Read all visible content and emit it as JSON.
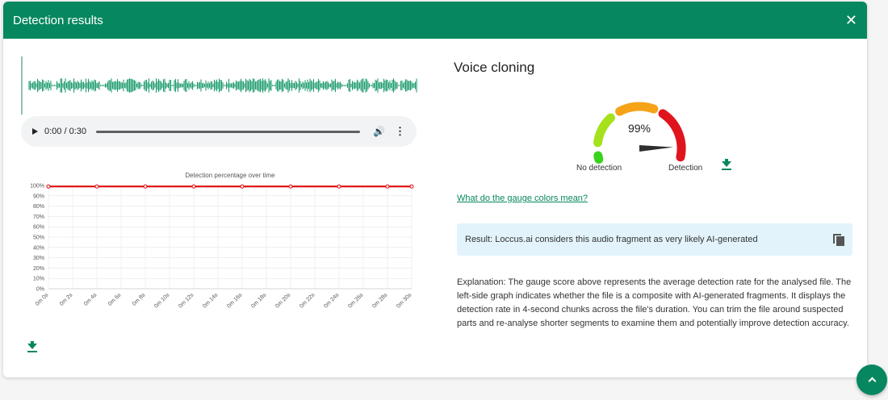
{
  "dialog": {
    "title": "Detection results",
    "close_icon": "close-icon"
  },
  "player": {
    "time": "0:00 / 0:30"
  },
  "voice": {
    "title": "Voice cloning",
    "score": "99%",
    "score_value": 0.99,
    "label_left": "No detection",
    "label_right": "Detection",
    "colors": {
      "green_bright": "#39d21d",
      "green_light": "#a6e11d",
      "orange": "#f5a317",
      "red": "#e0141d",
      "needle": "#2f2f2f"
    }
  },
  "link": "What do the gauge colors mean?",
  "result": "Result: Loccus.ai considers this audio fragment as very likely AI-generated",
  "explanation": "Explanation: The gauge score above represents the average detection rate for the analysed file. The left-side graph indicates whether the file is a composite with AI-generated fragments. It displays the detection rate in 4-second chunks across the file's duration. You can trim the file around suspected parts and re-analyse shorter segments to examine them and potentially improve detection accuracy.",
  "chart_data": {
    "type": "line",
    "title": "Detection percentage over time",
    "xlabel": "",
    "ylabel": "",
    "y_ticks": [
      "0%",
      "10%",
      "20%",
      "30%",
      "40%",
      "50%",
      "60%",
      "70%",
      "80%",
      "90%",
      "100%"
    ],
    "x_ticks": [
      "0m 0s",
      "0m 2s",
      "0m 4s",
      "0m 6s",
      "0m 8s",
      "0m 10s",
      "0m 12s",
      "0m 14s",
      "0m 16s",
      "0m 18s",
      "0m 20s",
      "0m 22s",
      "0m 24s",
      "0m 26s",
      "0m 28s",
      "0m 30s"
    ],
    "ylim": [
      0,
      100
    ],
    "xlim": [
      0,
      30
    ],
    "grid": true,
    "series": [
      {
        "color": "#e00000",
        "x": [
          0,
          4,
          8,
          12,
          16,
          20,
          24,
          28,
          30
        ],
        "y": [
          99,
          99,
          99,
          99,
          99,
          99,
          99,
          99,
          99
        ]
      }
    ]
  },
  "colors": {
    "primary": "#07875f",
    "waveform": "#1f9d6e",
    "info_bg": "#e3f3fb"
  }
}
